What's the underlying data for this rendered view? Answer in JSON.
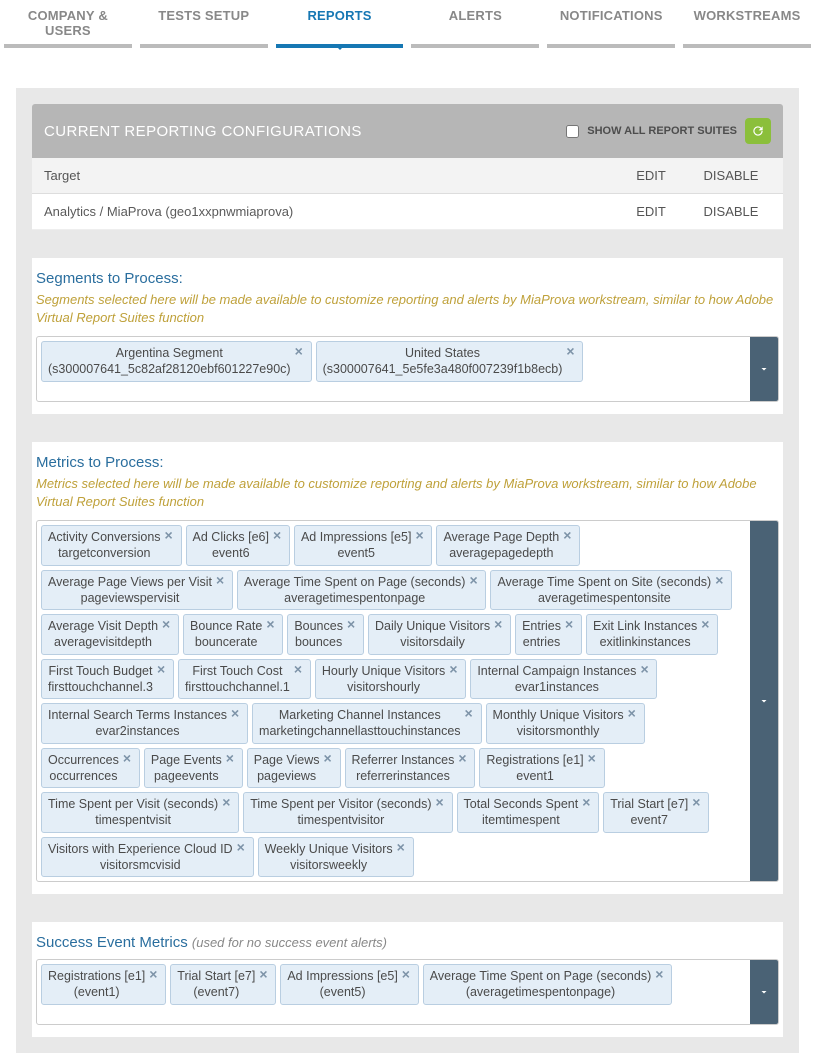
{
  "tabs": [
    "COMPANY & USERS",
    "TESTS SETUP",
    "REPORTS",
    "ALERTS",
    "NOTIFICATIONS",
    "WORKSTREAMS"
  ],
  "activeTab": 2,
  "panel": {
    "title": "CURRENT REPORTING CONFIGURATIONS",
    "showAllLabel": "SHOW ALL REPORT SUITES"
  },
  "table": {
    "header": {
      "main": "Target",
      "edit": "EDIT",
      "disable": "DISABLE"
    },
    "rows": [
      {
        "main": "Analytics / MiaProva (geo1xxpnwmiaprova)",
        "edit": "EDIT",
        "disable": "DISABLE"
      }
    ]
  },
  "segments": {
    "title": "Segments to Process:",
    "hint": "Segments selected here will be made available to customize reporting and alerts by MiaProva workstream, similar to how Adobe Virtual Report Suites function",
    "items": [
      {
        "top": "Argentina Segment",
        "bot": "(s300007641_5c82af28120ebf601227e90c)"
      },
      {
        "top": "United States",
        "bot": "(s300007641_5e5fe3a480f007239f1b8ecb)"
      }
    ]
  },
  "metrics": {
    "title": "Metrics to Process:",
    "hint": "Metrics selected here will be made available to customize reporting and alerts by MiaProva workstream, similar to how Adobe Virtual Report Suites function",
    "items": [
      {
        "top": "Activity Conversions",
        "bot": "targetconversion"
      },
      {
        "top": "Ad Clicks [e6]",
        "bot": "event6"
      },
      {
        "top": "Ad Impressions [e5]",
        "bot": "event5"
      },
      {
        "top": "Average Page Depth",
        "bot": "averagepagedepth"
      },
      {
        "top": "Average Page Views per Visit",
        "bot": "pageviewspervisit"
      },
      {
        "top": "Average Time Spent on Page (seconds)",
        "bot": "averagetimespentonpage"
      },
      {
        "top": "Average Time Spent on Site (seconds)",
        "bot": "averagetimespentonsite"
      },
      {
        "top": "Average Visit Depth",
        "bot": "averagevisitdepth"
      },
      {
        "top": "Bounce Rate",
        "bot": "bouncerate"
      },
      {
        "top": "Bounces",
        "bot": "bounces"
      },
      {
        "top": "Daily Unique Visitors",
        "bot": "visitorsdaily"
      },
      {
        "top": "Entries",
        "bot": "entries"
      },
      {
        "top": "Exit Link Instances",
        "bot": "exitlinkinstances"
      },
      {
        "top": "First Touch Budget",
        "bot": "firsttouchchannel.3"
      },
      {
        "top": "First Touch Cost",
        "bot": "firsttouchchannel.1"
      },
      {
        "top": "Hourly Unique Visitors",
        "bot": "visitorshourly"
      },
      {
        "top": "Internal Campaign Instances",
        "bot": "evar1instances"
      },
      {
        "top": "Internal Search Terms Instances",
        "bot": "evar2instances"
      },
      {
        "top": "Marketing Channel Instances",
        "bot": "marketingchannellasttouchinstances"
      },
      {
        "top": "Monthly Unique Visitors",
        "bot": "visitorsmonthly"
      },
      {
        "top": "Occurrences",
        "bot": "occurrences"
      },
      {
        "top": "Page Events",
        "bot": "pageevents"
      },
      {
        "top": "Page Views",
        "bot": "pageviews"
      },
      {
        "top": "Referrer Instances",
        "bot": "referrerinstances"
      },
      {
        "top": "Registrations [e1]",
        "bot": "event1"
      },
      {
        "top": "Time Spent per Visit (seconds)",
        "bot": "timespentvisit"
      },
      {
        "top": "Time Spent per Visitor (seconds)",
        "bot": "timespentvisitor"
      },
      {
        "top": "Total Seconds Spent",
        "bot": "itemtimespent"
      },
      {
        "top": "Trial Start [e7]",
        "bot": "event7"
      },
      {
        "top": "Visitors with Experience Cloud ID",
        "bot": "visitorsmcvisid"
      },
      {
        "top": "Weekly Unique Visitors",
        "bot": "visitorsweekly"
      }
    ]
  },
  "success": {
    "title": "Success Event Metrics",
    "subnote": "(used for no success event alerts)",
    "items": [
      {
        "top": "Registrations [e1]",
        "bot": "(event1)"
      },
      {
        "top": "Trial Start [e7]",
        "bot": "(event7)"
      },
      {
        "top": "Ad Impressions [e5]",
        "bot": "(event5)"
      },
      {
        "top": "Average Time Spent on Page (seconds)",
        "bot": "(averagetimespentonpage)"
      }
    ]
  }
}
